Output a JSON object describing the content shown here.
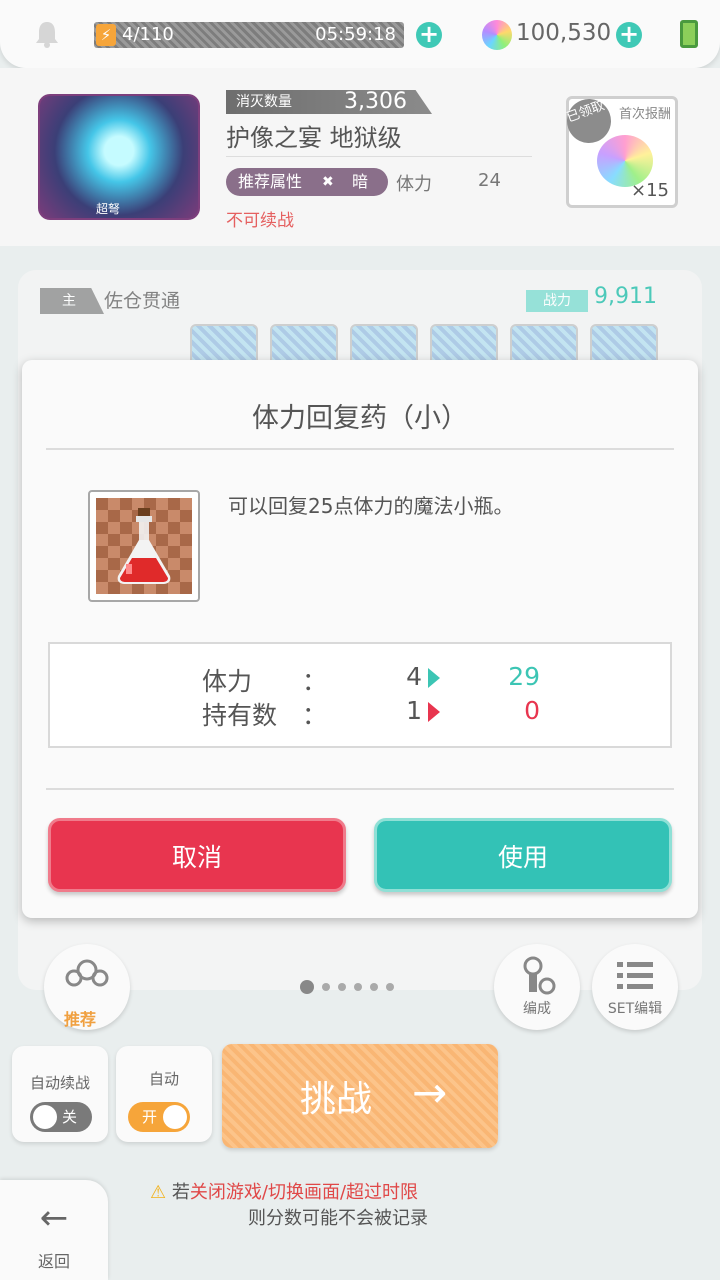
{
  "status_bar": {
    "stamina": "4/110",
    "timer": "05:59:18",
    "gems": "100,530"
  },
  "quest": {
    "boss_tag": "超弩",
    "kill_label": "消灭数量",
    "kill_count": "3,306",
    "title": "护像之宴 地狱级",
    "attr_label": "推荐属性",
    "attr_value": "暗",
    "stamina_label": "体力",
    "stamina_cost": "24",
    "no_continue": "不可续战",
    "reward_label": "首次报酬",
    "reward_badge": "已领取",
    "reward_count": "×15"
  },
  "party": {
    "main_tag": "主",
    "leader_name": "佐仓贯通",
    "power_label": "战力",
    "power_value": "9,911"
  },
  "modal": {
    "title": "体力回复药（小）",
    "description": "可以回复25点体力的魔法小瓶。",
    "rows": [
      {
        "label": "体力",
        "colon": "：",
        "from": "4",
        "to": "29",
        "to_color": "#3cc5b4"
      },
      {
        "label": "持有数",
        "colon": "：",
        "from": "1",
        "to": "0",
        "to_color": "#e8354f"
      }
    ],
    "cancel": "取消",
    "use": "使用"
  },
  "controls": {
    "recommend": "推荐",
    "formation": "编成",
    "set_edit": "SET编辑",
    "auto_continue_label": "自动续战",
    "auto_continue_state": "关",
    "auto_label": "自动",
    "auto_state": "开",
    "challenge": "挑战",
    "warning_prefix": "若",
    "warning_red": "关闭游戏/切换画面/超过时限",
    "warning_line2": "则分数可能不会被记录",
    "back": "返回"
  }
}
